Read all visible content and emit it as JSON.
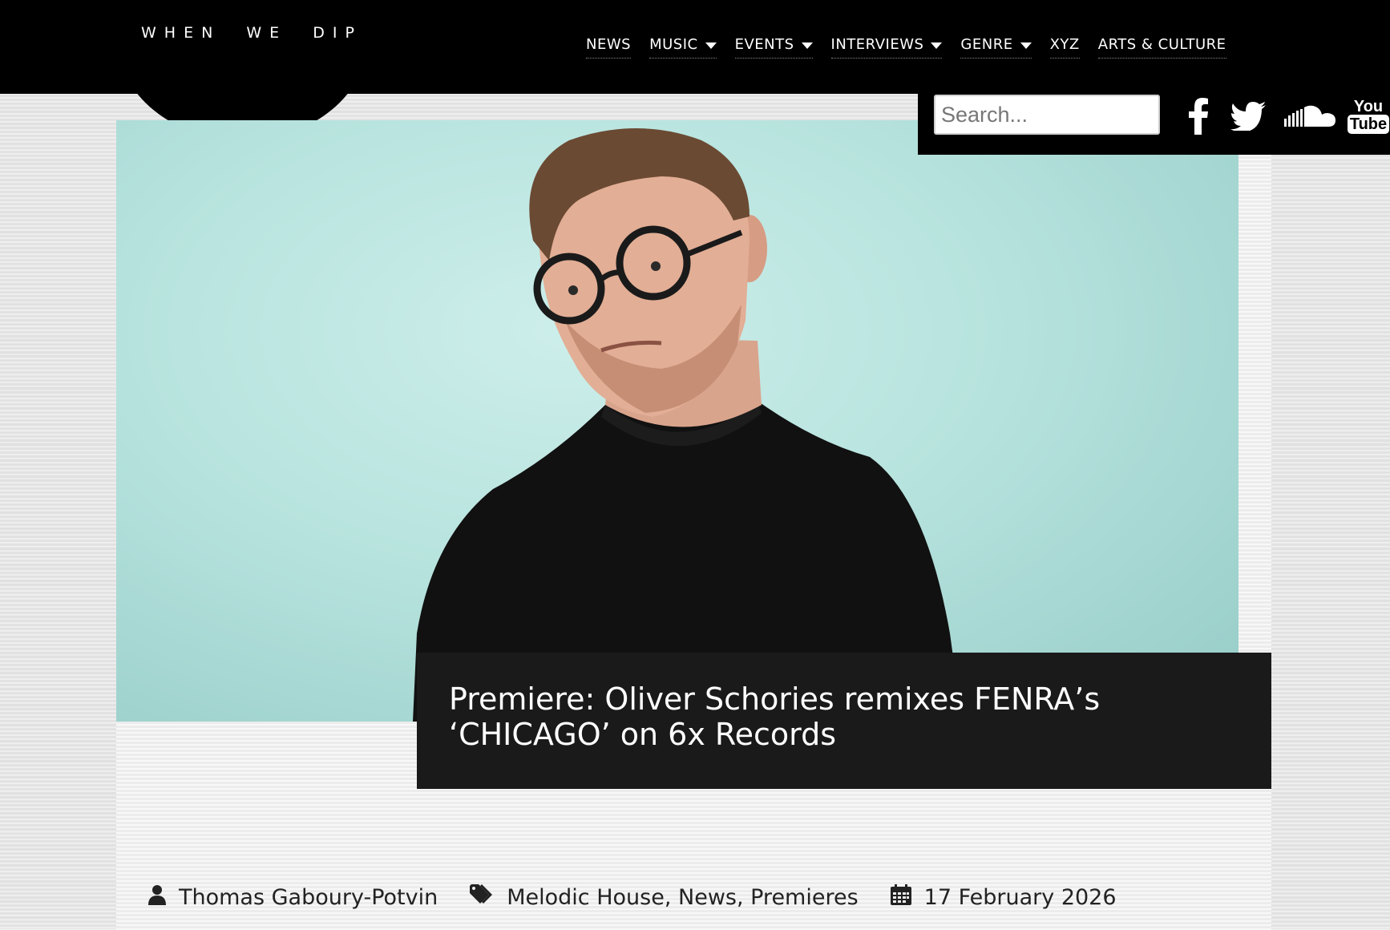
{
  "header": {
    "logo": "WHEN  WE  DIP",
    "nav": [
      {
        "label": "NEWS",
        "dropdown": false
      },
      {
        "label": "MUSIC",
        "dropdown": true
      },
      {
        "label": "EVENTS",
        "dropdown": true
      },
      {
        "label": "INTERVIEWS",
        "dropdown": true
      },
      {
        "label": "GENRE",
        "dropdown": true
      },
      {
        "label": "XYZ",
        "dropdown": false
      },
      {
        "label": "ARTS & CULTURE",
        "dropdown": false
      }
    ]
  },
  "tools": {
    "search": {
      "placeholder": "Search...",
      "value": ""
    },
    "social": [
      "facebook-icon",
      "twitter-icon",
      "soundcloud-icon",
      "youtube-icon"
    ],
    "youtube_label_top": "You",
    "youtube_label_bottom": "Tube"
  },
  "article": {
    "title": "Premiere: Oliver Schories remixes FENRA’s ‘CHICAGO’ on 6x Records",
    "author": "Thomas Gaboury-Potvin",
    "categories": "Melodic House, News, Premieres",
    "date": "17 February 2026"
  },
  "colors": {
    "header_bg": "#000000",
    "hero_bg": "#b7e3de",
    "title_bg": "#1a1a1a",
    "page_bg": "#e6e6e6"
  }
}
